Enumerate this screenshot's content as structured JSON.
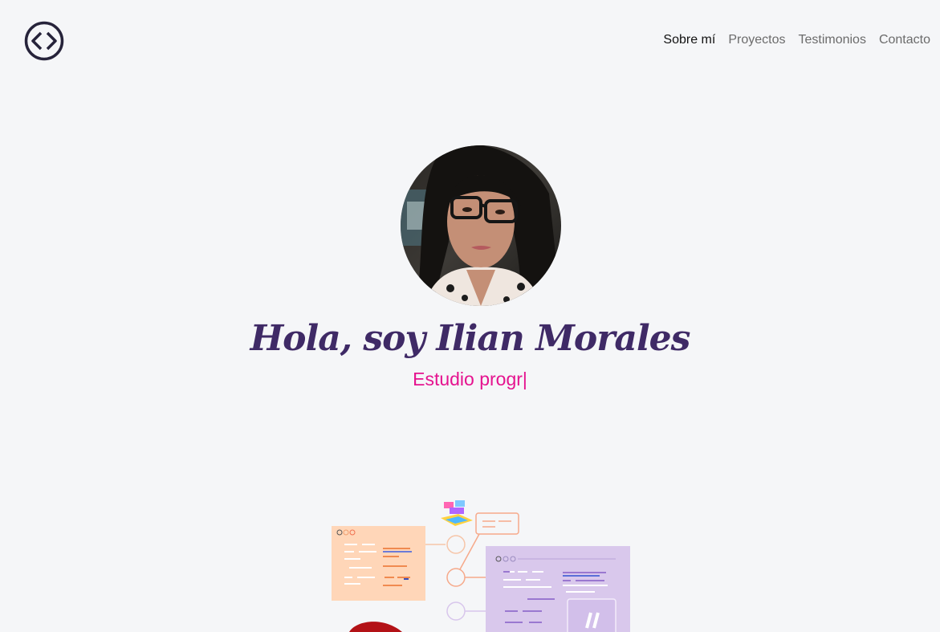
{
  "nav": {
    "logo_icon": "code-brackets-icon",
    "items": [
      {
        "label": "Sobre mí",
        "active": true
      },
      {
        "label": "Proyectos",
        "active": false
      },
      {
        "label": "Testimonios",
        "active": false
      },
      {
        "label": "Contacto",
        "active": false
      }
    ]
  },
  "hero": {
    "title": "Hola, soy Ilian Morales",
    "subtitle": "Estudio progr|"
  },
  "colors": {
    "background": "#f5f6f8",
    "title": "#3f2a66",
    "accent": "#e5138f"
  }
}
